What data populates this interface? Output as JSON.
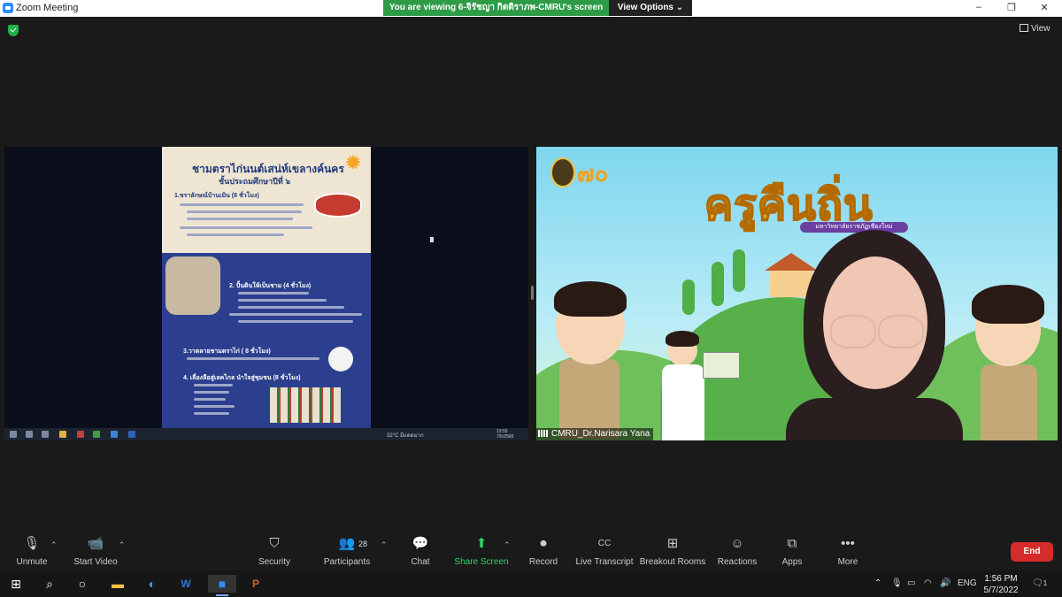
{
  "window": {
    "title": "Zoom Meeting",
    "minimize": "–",
    "maximize": "❐",
    "close": "✕"
  },
  "share_banner": {
    "text": "You are viewing 6-จิรัชญา กิตติราภพ-CMRU's screen",
    "view_options": "View Options ⌄"
  },
  "view_button": {
    "label": "View"
  },
  "shared_screen": {
    "poster": {
      "title": "ชามตราไก่นนต์เสน่ห์เขลางค์นคร",
      "subtitle": "ชั้นประถมศึกษาปีที่ ๖",
      "sections": [
        "1.ชราลักษณ์บ้านเมิน (8 ชั่วโมง)",
        "2. ปั้นดินให้เป็นชาม (4 ชั่วโมง)",
        "3.วาดลายชามตราไก่ ( 8 ชั่วโมง)",
        "4. เลื่องลือสู่เลคไกล นำใจสู่ชุมชน (8 ชั่วโมง)"
      ]
    },
    "taskbar": {
      "weather": "32°C มีแดดมาก",
      "time": "13:55",
      "date": "7/5/2565"
    }
  },
  "speaker": {
    "title": "ครูคืนถิ่น",
    "subtitle": "มหาวิทยาลัยราชภัฏเชียงใหม่",
    "name": "CMRU_Dr.Narisara Yana"
  },
  "controls": {
    "unmute": "Unmute",
    "start_video": "Start Video",
    "security": "Security",
    "participants": "Participants",
    "participants_count": "28",
    "chat": "Chat",
    "share_screen": "Share Screen",
    "record": "Record",
    "live_transcript": "Live Transcript",
    "breakout_rooms": "Breakout Rooms",
    "reactions": "Reactions",
    "apps": "Apps",
    "more": "More",
    "end": "End",
    "cc_icon": "CC"
  },
  "taskbar": {
    "language": "ENG",
    "time": "1:56 PM",
    "date": "5/7/2022",
    "notification_count": "1"
  },
  "colors": {
    "accent_green": "#2e9b47",
    "zoom_blue": "#2d8cff",
    "end_red": "#d52b2b",
    "title_yellow": "#f7c21c"
  }
}
